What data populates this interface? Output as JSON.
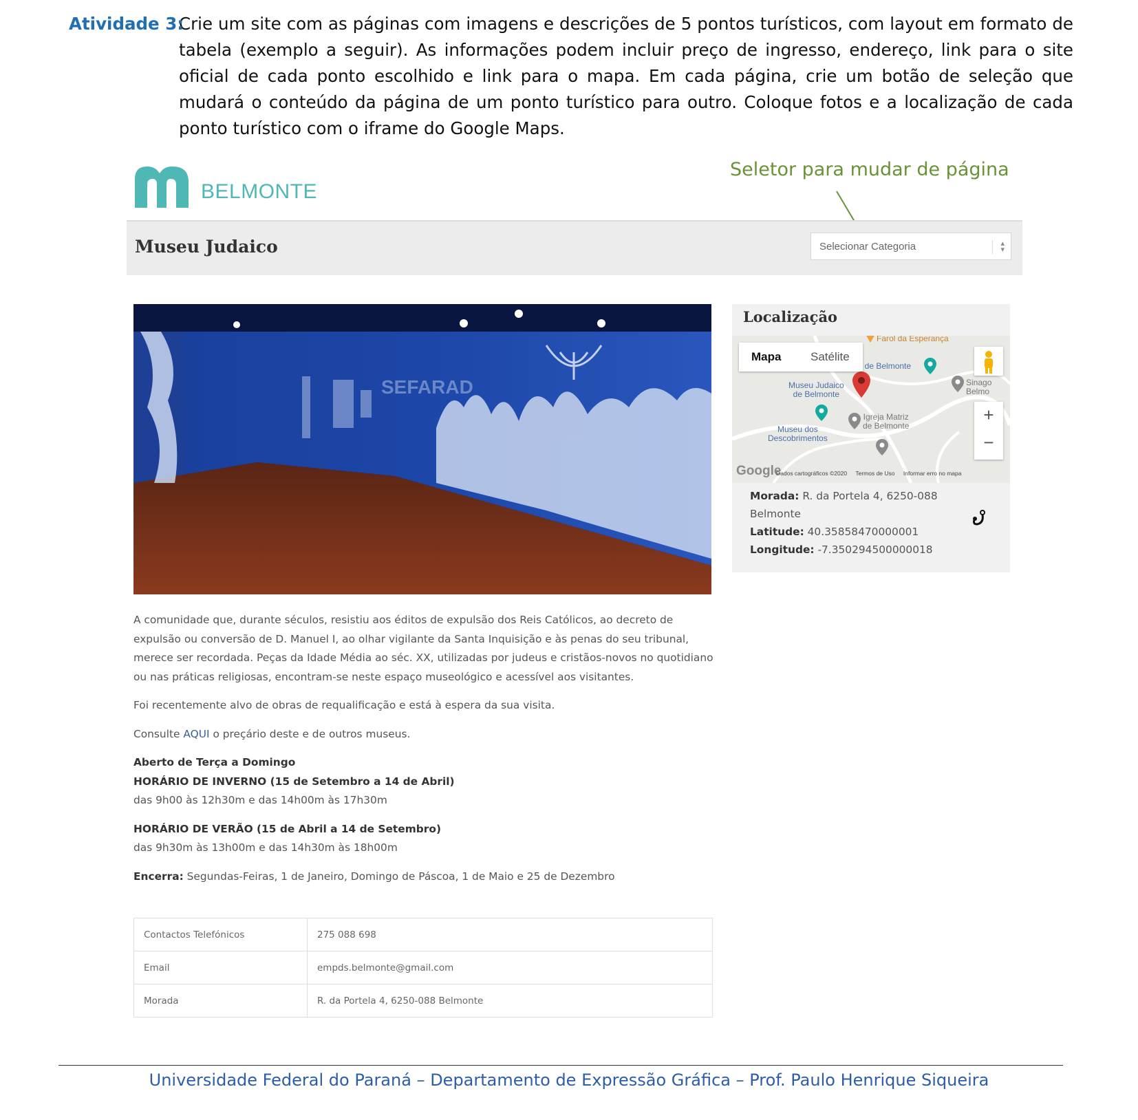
{
  "activity": {
    "label": "Atividade 3:",
    "text": "Crie um site com as páginas com imagens e descrições de 5 pontos turísticos, com layout em formato de tabela (exemplo a seguir). As informações podem incluir preço de ingresso, endereço, link para o site oficial de cada ponto escolhido e link para o mapa. Em cada página, crie um botão de seleção que mudará o conteúdo da página de um ponto turístico para outro. Coloque fotos e a localização de cada ponto turístico com o iframe do Google Maps."
  },
  "annotation": {
    "text": "Seletor para mudar de página",
    "color": "#6a9236"
  },
  "site": {
    "logo_text": "BELMONTE",
    "brand_color": "#4fb7b4",
    "page_title": "Museu Judaico",
    "select_placeholder": "Selecionar Categoria",
    "hero_text": "SEFARAD",
    "description": {
      "p1": "A comunidade que, durante séculos, resistiu aos éditos de expulsão dos Reis Católicos, ao decreto de expulsão ou conversão de D. Manuel I, ao olhar vigilante da Santa Inquisição e às penas do seu tribunal, merece ser recordada. Peças da Idade Média ao séc. XX, utilizadas por judeus e cristãos-novos no quotidiano ou nas práticas religiosas, encontram-se neste espaço museológico e acessível aos visitantes.",
      "p2": "Foi recentemente alvo de obras de requalificação e está à espera da sua visita.",
      "p3_before": "Consulte ",
      "p3_link": "AQUI",
      "p3_after": " o preçário deste e de outros museus.",
      "open_days": "Aberto de Terça a Domingo",
      "winter_title": "HORÁRIO DE INVERNO (15 de Setembro a 14 de Abril)",
      "winter_hours": "das 9h00 às 12h30m e das 14h00m às 17h30m",
      "summer_title": "HORÁRIO DE VERÃO (15 de Abril a 14 de Setembro)",
      "summer_hours": "das 9h30m às 13h00m e das 14h30m às 18h00m",
      "closed_label": "Encerra:",
      "closed_text": " Segundas-Feiras, 1 de Janeiro, Domingo de Páscoa, 1 de Maio e 25 de Dezembro"
    },
    "contacts": [
      {
        "label": "Contactos Telefónicos",
        "value": "275 088 698"
      },
      {
        "label": "Email",
        "value": "empds.belmonte@gmail.com"
      },
      {
        "label": "Morada",
        "value": "R. da Portela 4, 6250-088 Belmonte"
      }
    ],
    "location": {
      "title": "Localização",
      "tab_map": "Mapa",
      "tab_satellite": "Satélite",
      "labels": {
        "farol": "Farol da Esperança",
        "castelo": "...lo de Belmonte",
        "museu_judaico": "Museu Judaico\nde Belmonte",
        "sinagoga": "Sinago\nBelmo",
        "igreja": "Igreja Matriz\nde Belmonte",
        "descobrimentos": "Museu dos\nDescobrimentos"
      },
      "zoom_in": "+",
      "zoom_out": "−",
      "google": "Google",
      "footer": [
        "Dados cartográficos ©2020",
        "Termos de Uso",
        "Informar erro no mapa"
      ],
      "morada_label": "Morada:",
      "morada": " R. da Portela 4, 6250-088 Belmonte",
      "lat_label": "Latitude:",
      "lat": " 40.35858470000001",
      "lon_label": "Longitude:",
      "lon": " -7.350294500000018"
    }
  },
  "footer": "Universidade Federal do Paraná – Departamento de Expressão Gráfica – Prof. Paulo Henrique Siqueira"
}
